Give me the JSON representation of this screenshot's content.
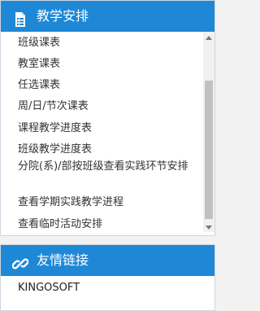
{
  "teaching_panel": {
    "title": "教学安排",
    "items": [
      "班级课表",
      "教室课表",
      "任选课表",
      "周/日/节次课表",
      "课程教学进度表",
      "班级教学进度表",
      "分院(系)/部按班级查看实践环节安排",
      "查看学期实践教学进程",
      "查看临时活动安排"
    ]
  },
  "links_panel": {
    "title": "友情链接",
    "items": [
      "KINGOSOFT"
    ]
  },
  "colors": {
    "header_bg": "#1e88d6",
    "header_text": "#ffffff",
    "scroll_thumb": "#c1c1c1"
  },
  "icons": {
    "teaching_header": "list-document-icon",
    "links_header": "chain-link-icon",
    "scroll_up": "triangle-up-icon",
    "scroll_down": "triangle-down-icon"
  }
}
